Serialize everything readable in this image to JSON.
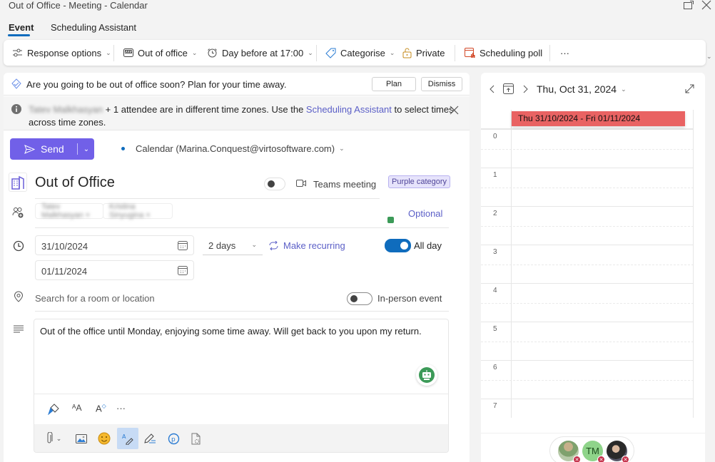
{
  "window": {
    "title": "Out of Office - Meeting - Calendar",
    "icons": [
      "popout-icon",
      "close-icon"
    ]
  },
  "tabs": [
    {
      "label": "Event",
      "active": true
    },
    {
      "label": "Scheduling Assistant",
      "active": false
    }
  ],
  "toolbar": {
    "response_options": "Response options",
    "show_as": "Out of office",
    "reminder": "Day before at 17:00",
    "categorise": "Categorise",
    "private": "Private",
    "scheduling_poll": "Scheduling poll",
    "more": "···"
  },
  "ooo_banner": {
    "text": "Are you going to be out of office soon? Plan for your time away.",
    "plan": "Plan",
    "dismiss": "Dismiss"
  },
  "timezone_banner": {
    "blurred_name": "Tatev Malkhasyan",
    "text_before_link": " + 1 attendee are in different time zones. Use the ",
    "link": "Scheduling Assistant",
    "text_after_link": " to select times",
    "line2": "across time zones."
  },
  "send": {
    "label": "Send",
    "calendar": "Calendar (Marina.Conquest@virtosoftware.com)"
  },
  "event": {
    "title": "Out of Office",
    "teams_meeting_label": "Teams meeting",
    "teams_meeting_on": false,
    "category": "Purple category",
    "attendees": [
      "Tatev Malkhasyan ×",
      "Kristina Sinyugina ×"
    ],
    "optional_label": "Optional",
    "start_date": "31/10/2024",
    "end_date": "01/11/2024",
    "duration": "2 days",
    "make_recurring": "Make recurring",
    "all_day_label": "All day",
    "all_day_on": true,
    "location_placeholder": "Search for a room or location",
    "in_person_label": "In-person event",
    "in_person_on": false,
    "body": "Out of the office until Monday, enjoying some time away. Will get back to you upon my return."
  },
  "format_toolbar": {
    "more": "···"
  },
  "day_view": {
    "date": "Thu, Oct 31, 2024",
    "all_day_event": "Thu 31/10/2024 - Fri 01/11/2024",
    "hours": [
      "0",
      "1",
      "2",
      "3",
      "4",
      "5",
      "6",
      "7"
    ],
    "event_color": "#e96363"
  },
  "attendee_avatars": [
    {
      "initials": "",
      "status": "declined"
    },
    {
      "initials": "TM",
      "status": "declined"
    },
    {
      "initials": "",
      "status": "declined"
    }
  ],
  "colors": {
    "accent": "#7160e8",
    "link": "#5b5fc7",
    "toggle_on": "#0f6cbd"
  }
}
